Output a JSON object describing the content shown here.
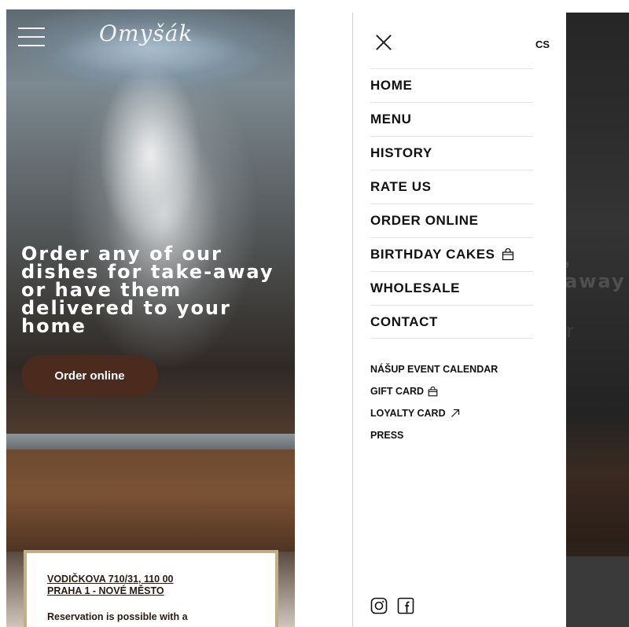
{
  "home": {
    "logo": "Omyšák",
    "headline_lines": [
      "Order any of our",
      "dishes for take-away",
      "or have them",
      "delivered to your",
      "home"
    ],
    "cta_label": "Order online",
    "card": {
      "address_line1": "VODIČKOVA 710/31, 110 00",
      "address_line2": "PRAHA 1 - NOVÉ MĚSTO",
      "reservation_text": "Reservation is possible with a"
    }
  },
  "drawer": {
    "language": "CS",
    "main_items": [
      {
        "label": "HOME"
      },
      {
        "label": "MENU"
      },
      {
        "label": "HISTORY"
      },
      {
        "label": "RATE US"
      },
      {
        "label": "ORDER ONLINE"
      },
      {
        "label": "BIRTHDAY CAKES",
        "icon": "shopping-bag-icon"
      },
      {
        "label": "WHOLESALE"
      },
      {
        "label": "CONTACT"
      }
    ],
    "secondary_items": [
      {
        "label": "NÁŠUP EVENT CALENDAR"
      },
      {
        "label": "GIFT CARD",
        "icon": "shopping-bag-icon"
      },
      {
        "label": "LOYALTY CARD",
        "icon": "external-link-icon"
      },
      {
        "label": "PRESS"
      }
    ],
    "social_icons": [
      "instagram-icon",
      "facebook-icon"
    ]
  },
  "background_peek": {
    "text": "away",
    "colors": {
      "overlay": "#2a2a2a"
    }
  },
  "colors": {
    "brand_brown": "#4a2b1d",
    "card_border": "#c4ae83",
    "text_dark": "#111111"
  }
}
